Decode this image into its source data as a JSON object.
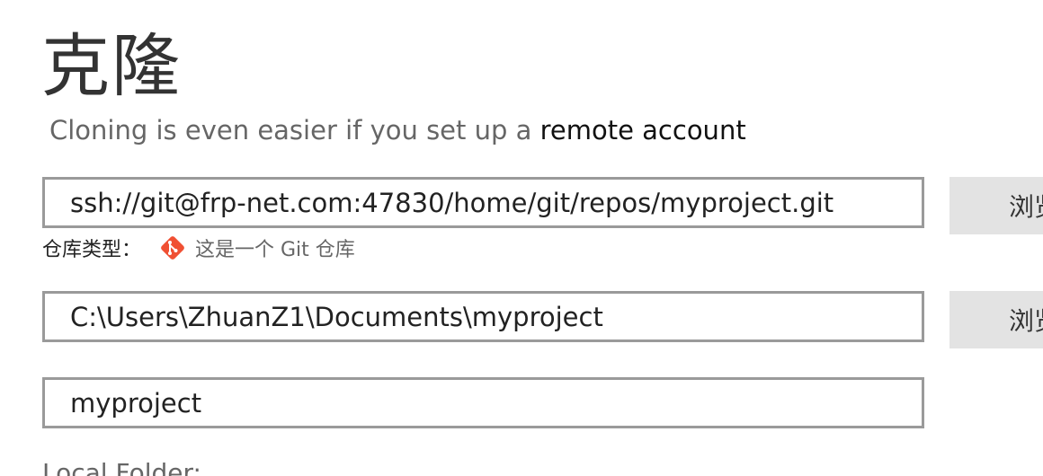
{
  "header": {
    "title": "克隆",
    "subtitle_prefix": "Cloning is even easier if you set up a",
    "subtitle_link": "remote account"
  },
  "repo_url": {
    "value": "ssh://git@frp-net.com:47830/home/git/repos/myproject.git",
    "browse_label": "浏览"
  },
  "repo_type": {
    "label": "仓库类型：",
    "icon": "git-logo-icon",
    "value": "这是一个 Git 仓库",
    "icon_color": "#f05033"
  },
  "destination": {
    "value": "C:\\Users\\ZhuanZ1\\Documents\\myproject",
    "browse_label": "浏览"
  },
  "name": {
    "value": "myproject"
  },
  "local_folder": {
    "label": "Local Folder:"
  },
  "colors": {
    "field_border": "#9a9a9a",
    "button_bg": "#e3e3e3",
    "title_text": "#333333",
    "muted_text": "#666666"
  }
}
